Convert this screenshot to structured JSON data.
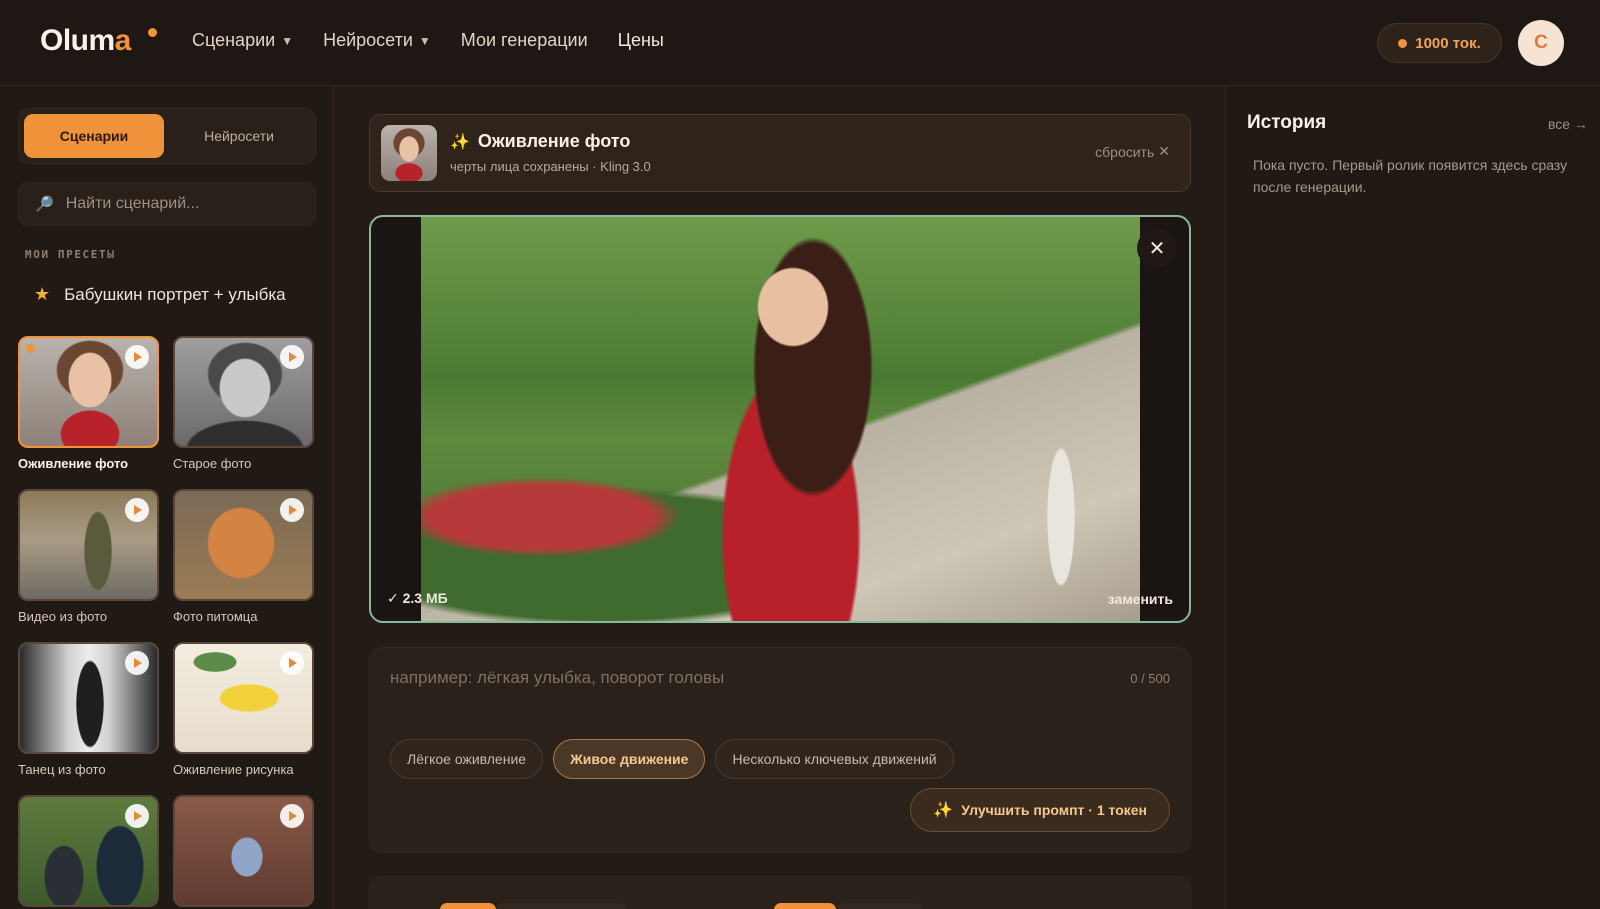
{
  "header": {
    "logo": "Oluma",
    "nav": [
      {
        "label": "Сценарии",
        "has_caret": true
      },
      {
        "label": "Нейросети",
        "has_caret": true
      },
      {
        "label": "Мои генерации",
        "has_caret": false
      },
      {
        "label": "Цены",
        "has_caret": false
      }
    ],
    "caret_icon": "▼",
    "tokens": "1000 ток.",
    "avatar_initial": "С"
  },
  "sidebar": {
    "tabs": [
      "Сценарии",
      "Нейросети"
    ],
    "active_tab": "Сценарии",
    "search_placeholder": "Найти сценарий...",
    "presets_label": "МОИ ПРЕСЕТЫ",
    "preset": "Бабушкин портрет + улыбка",
    "cards": [
      {
        "label": "Оживление фото",
        "selected": true
      },
      {
        "label": "Старое фото",
        "selected": false
      },
      {
        "label": "Видео из фото",
        "selected": false
      },
      {
        "label": "Фото питомца",
        "selected": false
      },
      {
        "label": "Танец из фото",
        "selected": false
      },
      {
        "label": "Оживление рисунка",
        "selected": false
      },
      {
        "label": "",
        "selected": false
      },
      {
        "label": "",
        "selected": false
      }
    ]
  },
  "main": {
    "scenario_title": "Оживление фото",
    "scenario_sub": "черты лица сохранены · Kling 3.0",
    "reset_label": "сбросить",
    "file_size": "✓ 2.3 МБ",
    "replace_label": "заменить",
    "prompt_placeholder": "например: лёгкая улыбка, поворот головы",
    "counter": "0 / 500",
    "chips": [
      "Лёгкое оживление",
      "Живое движение",
      "Несколько ключевых движений"
    ],
    "active_chip": "Живое движение",
    "improve_label": "Улучшить промпт · 1 токен"
  },
  "history": {
    "title": "История",
    "all_link": "все →",
    "empty_text": "Пока пусто. Первый ролик появится здесь сразу после генерации."
  },
  "colors": {
    "accent": "#f0923a",
    "background": "#241b16",
    "photo_border": "#86b89a"
  }
}
